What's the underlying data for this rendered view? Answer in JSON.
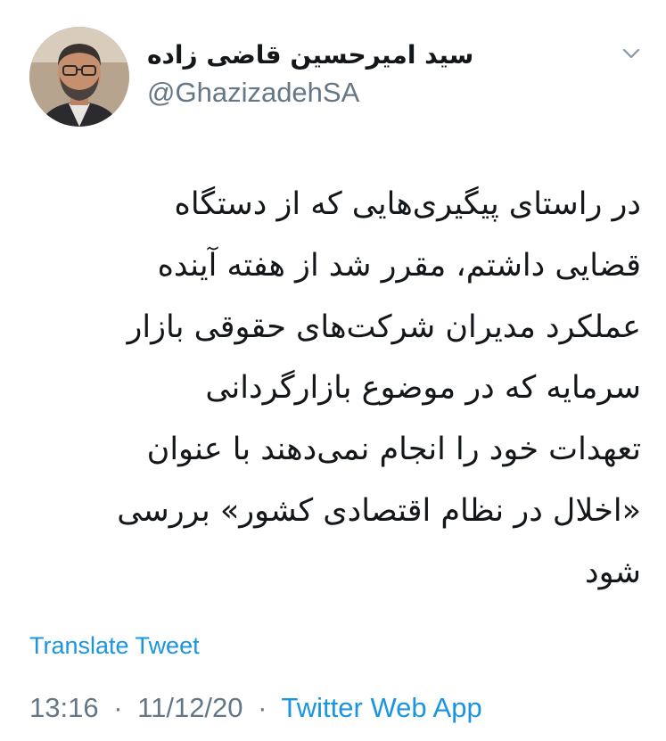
{
  "author": {
    "display_name": "سید امیرحسین قاضی زاده",
    "handle": "@GhazizadehSA"
  },
  "tweet": {
    "text": "در راستای پیگیری‌هایی که از دستگاه\nقضایی داشتم، مقرر شد از هفته آینده\nعملکرد مدیران شرکت‌های حقوقی بازار\nسرمایه که در موضوع بازارگردانی\nتعهدات خود را انجام نمی‌دهند با عنوان\n«اخلال در نظام اقتصادی کشور» بررسی\nشود",
    "translate_label": "Translate Tweet",
    "time": "13:16",
    "separator": "·",
    "date": "11/12/20",
    "source": "Twitter Web App"
  },
  "icons": {
    "menu": "chevron-down-icon",
    "avatar": "avatar"
  },
  "colors": {
    "link": "#1b95e0",
    "secondary_text": "#657786",
    "primary_text": "#14171a",
    "background": "#ffffff"
  }
}
